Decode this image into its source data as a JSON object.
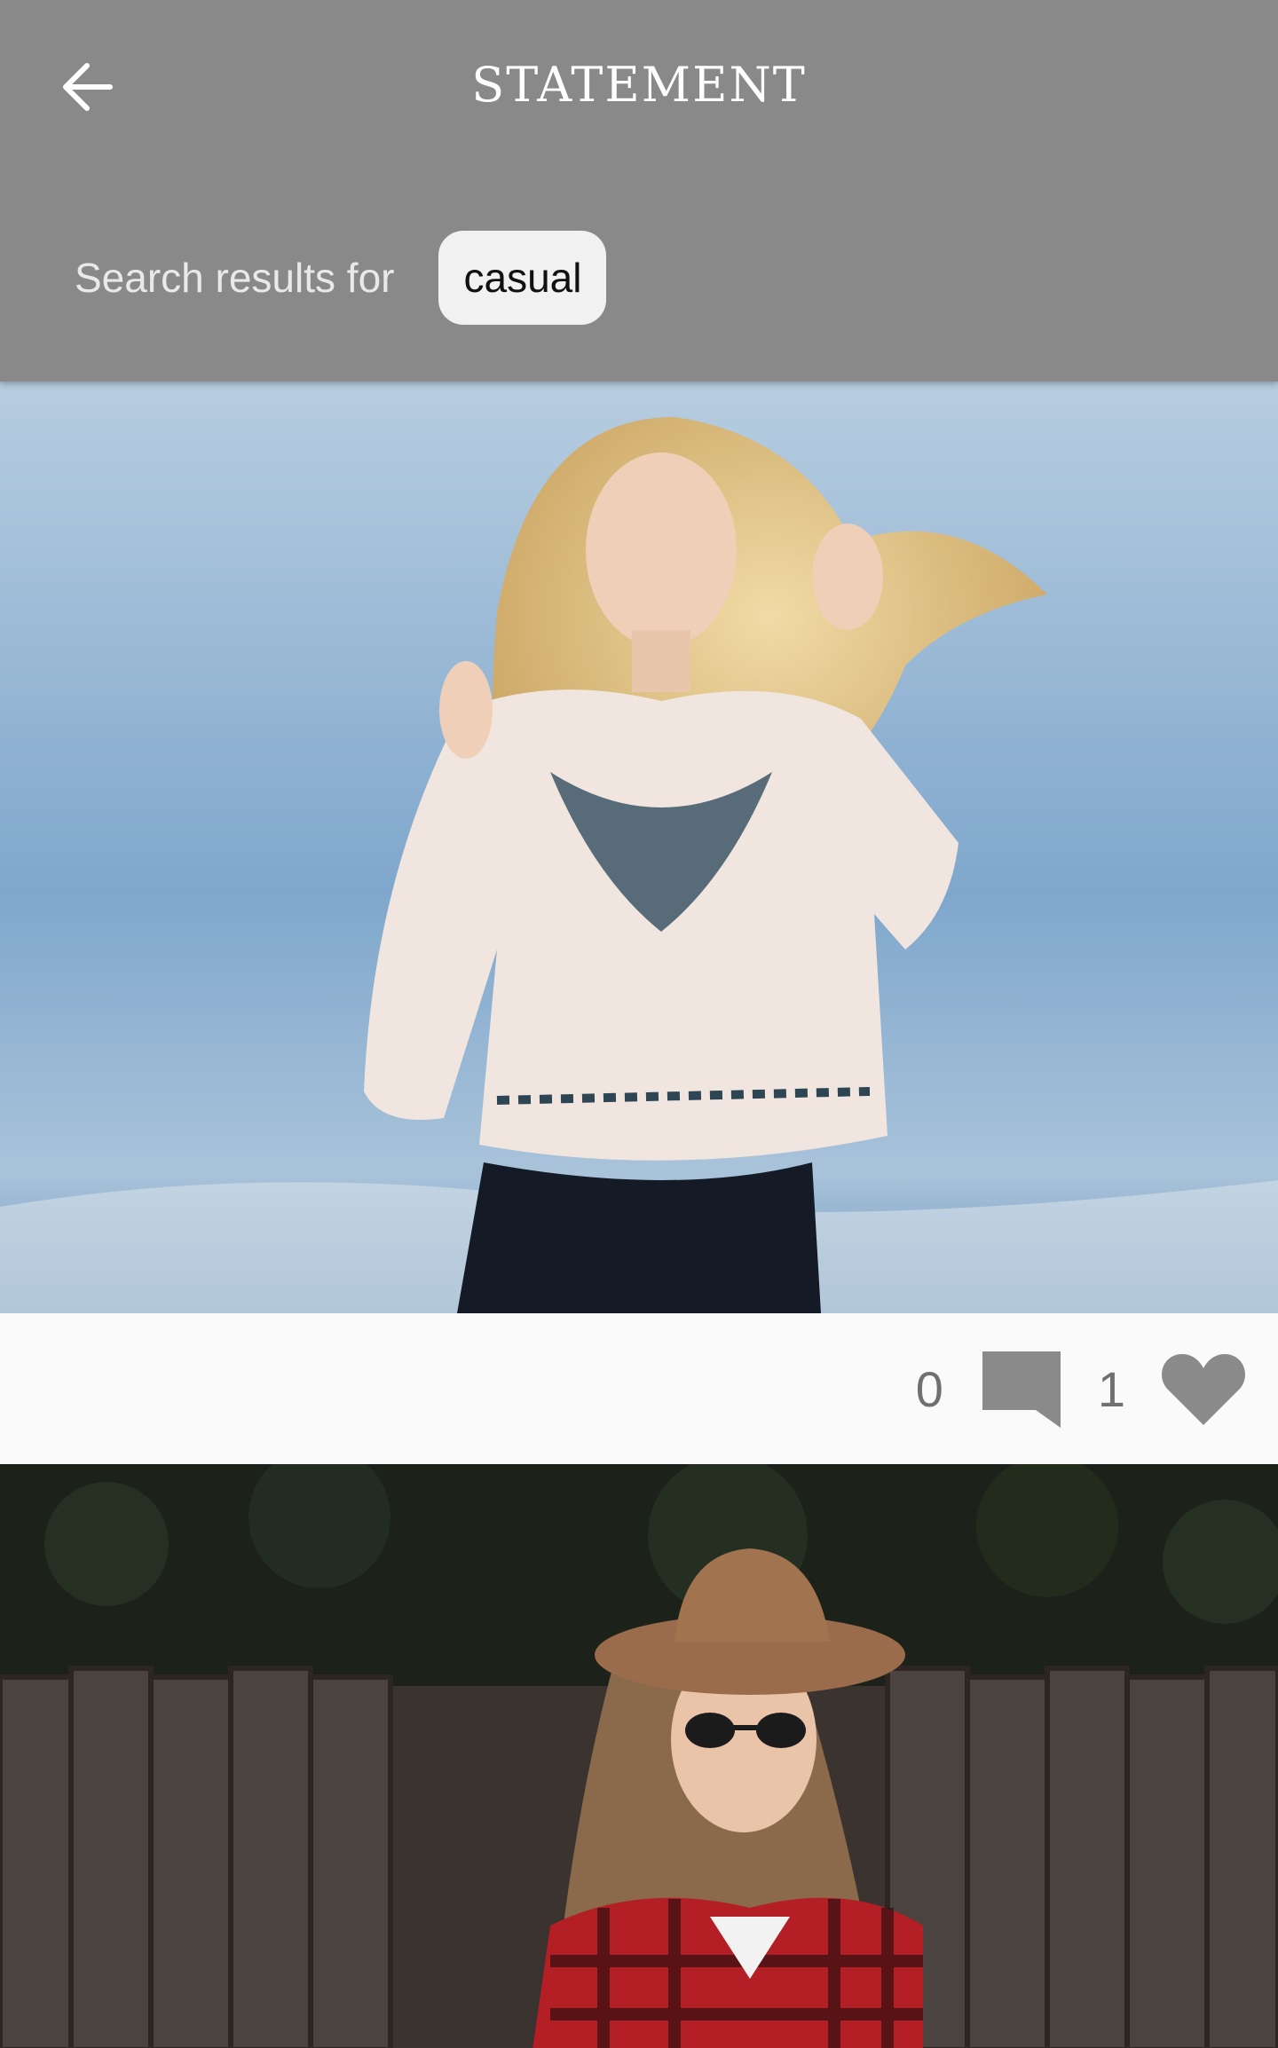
{
  "header": {
    "title": "STATEMENT",
    "back_icon": "arrow-left-icon"
  },
  "search": {
    "label": "Search results for",
    "chip": "casual"
  },
  "posts": [
    {
      "image_desc": "model-in-embroidered-crop-top",
      "comments_count": "0",
      "likes_count": "1",
      "comment_icon": "comment-icon",
      "like_icon": "heart-icon"
    },
    {
      "image_desc": "woman-in-hat-and-plaid-shirt"
    }
  ],
  "colors": {
    "appbar": "#898989",
    "meta_icons": "#8a8a8a",
    "chip_bg": "#f1f1f1"
  }
}
